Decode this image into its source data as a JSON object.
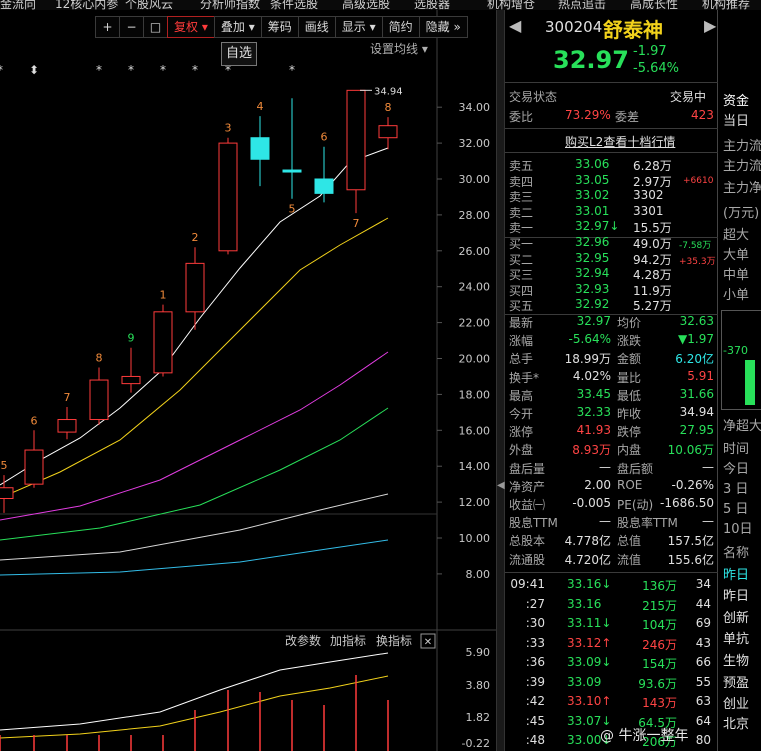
{
  "top_menu": [
    "金流向",
    "12核心内参",
    "个股风云",
    "分析师指数",
    "条件选股",
    "高级选股",
    "选股器",
    "机构增仓",
    "热点追击",
    "高成长性",
    "机构推荐"
  ],
  "toolbar": {
    "plus": "+",
    "minus": "−",
    "box": "□",
    "fq": "复权",
    "overlay": "叠加",
    "chip": "筹码",
    "draw": "画线",
    "display": "显示",
    "simple": "简约",
    "hide": "隐藏"
  },
  "settings_ma": "设置均线",
  "price_axis": [
    "34.00",
    "32.00",
    "30.00",
    "28.00",
    "26.00",
    "24.00",
    "22.00",
    "20.00",
    "18.00",
    "16.00",
    "14.00",
    "12.00",
    "10.00",
    "8.00"
  ],
  "high_label": "34.94",
  "candle_labels": [
    "5",
    "6",
    "7",
    "8",
    "9",
    "1",
    "2",
    "3",
    "4",
    "5",
    "6",
    "7",
    "8"
  ],
  "event_marks": [
    "*",
    "⬍",
    "*",
    "*",
    "*",
    "*",
    "*"
  ],
  "indicator_bar": {
    "params": "改参数",
    "add": "加指标",
    "switch": "换指标",
    "close": "✕"
  },
  "indicator_axis": [
    "5.90",
    "3.80",
    "1.82",
    "-0.22"
  ],
  "stock": {
    "code": "300204",
    "name": "舒泰神",
    "price": "32.97",
    "change": "-1.97",
    "change_pct": "-5.64%",
    "watch_label": "自选"
  },
  "status": {
    "label": "交易状态",
    "value": "交易中"
  },
  "ratio": {
    "wb_label": "委比",
    "wb_value": "73.29%",
    "wc_label": "委差",
    "wc_value": "423"
  },
  "l2_label": "购买L2查看十档行情",
  "asks": [
    {
      "label": "卖五",
      "price": "33.06",
      "vol": "6.28万",
      "delta": ""
    },
    {
      "label": "卖四",
      "price": "33.05",
      "vol": "2.97万",
      "delta": "+6610"
    },
    {
      "label": "卖三",
      "price": "33.02",
      "vol": "3302",
      "delta": ""
    },
    {
      "label": "卖二",
      "price": "33.01",
      "vol": "3301",
      "delta": ""
    },
    {
      "label": "卖一",
      "price": "32.97↓",
      "vol": "15.5万",
      "delta": ""
    }
  ],
  "bids": [
    {
      "label": "买一",
      "price": "32.96",
      "vol": "49.0万",
      "delta": "-7.58万"
    },
    {
      "label": "买二",
      "price": "32.95",
      "vol": "94.2万",
      "delta": "+35.3万"
    },
    {
      "label": "买三",
      "price": "32.94",
      "vol": "4.28万",
      "delta": ""
    },
    {
      "label": "买四",
      "price": "32.93",
      "vol": "11.9万",
      "delta": ""
    },
    {
      "label": "买五",
      "price": "32.92",
      "vol": "5.27万",
      "delta": ""
    }
  ],
  "stats": [
    {
      "l1": "最新",
      "v1": "32.97",
      "c1": "green",
      "l2": "均价",
      "v2": "32.63",
      "c2": "green"
    },
    {
      "l1": "涨幅",
      "v1": "-5.64%",
      "c1": "green",
      "l2": "涨跌",
      "v2": "▼1.97",
      "c2": "green"
    },
    {
      "l1": "总手",
      "v1": "18.99万",
      "c1": "white",
      "l2": "金额",
      "v2": "6.20亿",
      "c2": "cyan"
    },
    {
      "l1": "换手*",
      "v1": "4.02%",
      "c1": "white",
      "l2": "量比",
      "v2": "5.91",
      "c2": "red"
    },
    {
      "l1": "最高",
      "v1": "33.45",
      "c1": "green",
      "l2": "最低",
      "v2": "31.66",
      "c2": "green"
    },
    {
      "l1": "今开",
      "v1": "32.33",
      "c1": "green",
      "l2": "昨收",
      "v2": "34.94",
      "c2": "white"
    },
    {
      "l1": "涨停",
      "v1": "41.93",
      "c1": "red",
      "l2": "跌停",
      "v2": "27.95",
      "c2": "green"
    },
    {
      "l1": "外盘",
      "v1": "8.93万",
      "c1": "red",
      "l2": "内盘",
      "v2": "10.06万",
      "c2": "green"
    },
    {
      "l1": "盘后量",
      "v1": "—",
      "c1": "white",
      "l2": "盘后额",
      "v2": "—",
      "c2": "white"
    },
    {
      "l1": "净资产",
      "v1": "2.00",
      "c1": "white",
      "l2": "ROE",
      "v2": "-0.26%",
      "c2": "white"
    },
    {
      "l1": "收益㈠",
      "v1": "-0.005",
      "c1": "white",
      "l2": "PE(动)",
      "v2": "-1686.50",
      "c2": "white"
    },
    {
      "l1": "股息TTM",
      "v1": "—",
      "c1": "white",
      "l2": "股息率TTM",
      "v2": "—",
      "c2": "white"
    },
    {
      "l1": "总股本",
      "v1": "4.778亿",
      "c1": "white",
      "l2": "总值",
      "v2": "157.5亿",
      "c2": "white"
    },
    {
      "l1": "流通股",
      "v1": "4.720亿",
      "c1": "white",
      "l2": "流值",
      "v2": "155.6亿",
      "c2": "white"
    }
  ],
  "ticks": [
    {
      "time": "09:41",
      "price": "33.16↓",
      "pc": "green",
      "vol": "136万",
      "vc": "green",
      "n": "34"
    },
    {
      "time": ":27",
      "price": "33.16",
      "pc": "green",
      "vol": "215万",
      "vc": "green",
      "n": "44"
    },
    {
      "time": ":30",
      "price": "33.11↓",
      "pc": "green",
      "vol": "104万",
      "vc": "green",
      "n": "69"
    },
    {
      "time": ":33",
      "price": "33.12↑",
      "pc": "red",
      "vol": "246万",
      "vc": "red",
      "n": "43"
    },
    {
      "time": ":36",
      "price": "33.09↓",
      "pc": "green",
      "vol": "154万",
      "vc": "green",
      "n": "66"
    },
    {
      "time": ":39",
      "price": "33.09",
      "pc": "green",
      "vol": "93.6万",
      "vc": "green",
      "n": "55"
    },
    {
      "time": ":42",
      "price": "33.10↑",
      "pc": "red",
      "vol": "143万",
      "vc": "red",
      "n": "63"
    },
    {
      "time": ":45",
      "price": "33.07↓",
      "pc": "green",
      "vol": "64.5万",
      "vc": "green",
      "n": "64"
    },
    {
      "time": ":48",
      "price": "33.00↓",
      "pc": "green",
      "vol": "206万",
      "vc": "green",
      "n": "80"
    }
  ],
  "side": {
    "tabs": [
      "资金",
      "当日"
    ],
    "items": [
      "主力流",
      "主力流",
      "主力净",
      "(万元)",
      "超大",
      "大单",
      "中单",
      "小单",
      "-370",
      "净超大",
      "时间",
      "今日",
      "3 日",
      "5 日",
      "10日",
      "名称",
      "昨日",
      "昨日",
      "创新",
      "单抗",
      "生物",
      "预盈",
      "创业",
      "北京"
    ]
  },
  "watermark": "@ 牛涨一整年"
}
